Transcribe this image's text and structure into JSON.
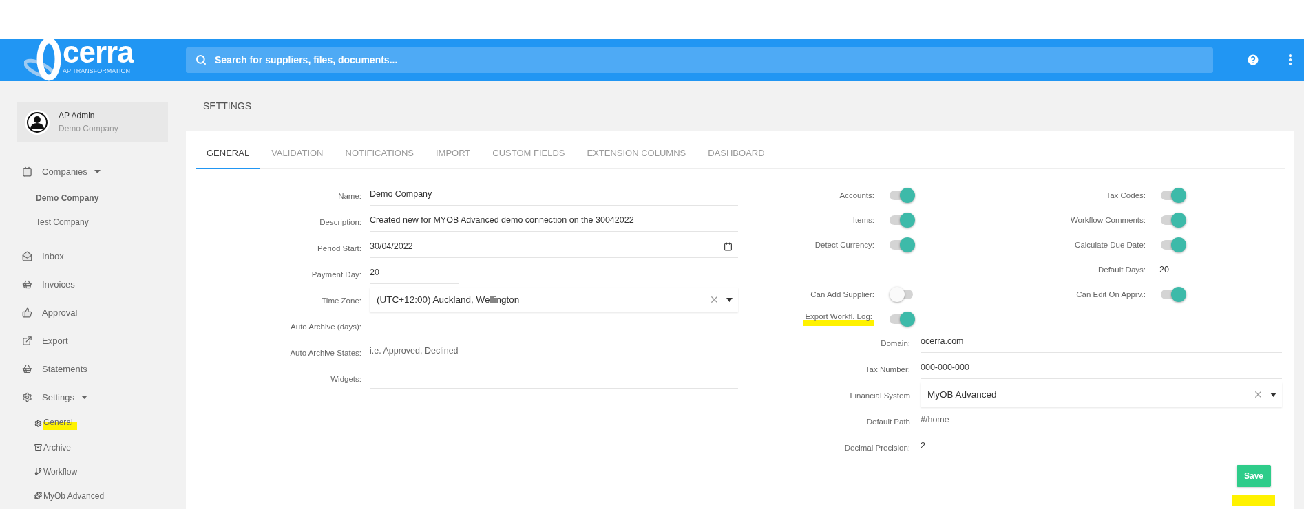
{
  "header": {
    "logo": {
      "text": "cerra",
      "tagline": "AP TRANSFORMATION"
    },
    "search": {
      "placeholder": "Search for suppliers, files, documents..."
    }
  },
  "user": {
    "name": "AP Admin",
    "company": "Demo Company"
  },
  "sidebar": {
    "items": [
      {
        "label": "Companies",
        "expanded": true,
        "children": [
          {
            "label": "Demo Company",
            "selected": true,
            "highlighted": false
          },
          {
            "label": "Test Company",
            "selected": false,
            "highlighted": false
          }
        ]
      },
      {
        "label": "Inbox"
      },
      {
        "label": "Invoices"
      },
      {
        "label": "Approval"
      },
      {
        "label": "Export"
      },
      {
        "label": "Statements"
      },
      {
        "label": "Settings",
        "expanded": true,
        "children": [
          {
            "label": "General",
            "selected": false,
            "highlighted": true
          },
          {
            "label": "Archive",
            "selected": false,
            "highlighted": false
          },
          {
            "label": "Workflow",
            "selected": false,
            "highlighted": false
          },
          {
            "label": "MyOb Advanced",
            "selected": false,
            "highlighted": false
          }
        ]
      }
    ]
  },
  "page_title": "SETTINGS",
  "tabs": [
    {
      "label": "GENERAL",
      "selected": true
    },
    {
      "label": "VALIDATION",
      "selected": false
    },
    {
      "label": "NOTIFICATIONS",
      "selected": false
    },
    {
      "label": "IMPORT",
      "selected": false
    },
    {
      "label": "CUSTOM FIELDS",
      "selected": false
    },
    {
      "label": "EXTENSION COLUMNS",
      "selected": false
    },
    {
      "label": "DASHBOARD",
      "selected": false
    }
  ],
  "general_form": [
    {
      "kind": "text",
      "label": "Name:",
      "value": "Demo Company"
    },
    {
      "kind": "text",
      "label": "Description:",
      "value": "Created new for MYOB Advanced demo connection on the 30042022"
    },
    {
      "kind": "date",
      "label": "Period Start:",
      "value": "30/04/2022"
    },
    {
      "kind": "short",
      "label": "Payment Day:",
      "value": "20"
    },
    {
      "kind": "select",
      "label": "Time Zone:",
      "value": "(UTC+12:00) Auckland, Wellington"
    },
    {
      "kind": "short",
      "label": "Auto Archive (days):"
    },
    {
      "kind": "text",
      "label": "Auto Archive States:",
      "placeholder": "i.e. Approved, Declined"
    },
    {
      "kind": "text",
      "label": "Widgets:"
    }
  ],
  "toggle_rows": [
    {
      "left": {
        "kind": "toggle",
        "label": "Accounts:",
        "on": true,
        "highlighted": false
      },
      "right": {
        "kind": "toggle",
        "label": "Tax Codes:",
        "on": true
      }
    },
    {
      "left": {
        "kind": "toggle",
        "label": "Items:",
        "on": true,
        "highlighted": false
      },
      "right": {
        "kind": "toggle",
        "label": "Workflow Comments:",
        "on": true
      }
    },
    {
      "left": {
        "kind": "toggle",
        "label": "Detect Currency:",
        "on": true,
        "highlighted": false
      },
      "right": {
        "kind": "toggle",
        "label": "Calculate Due Date:",
        "on": true
      }
    },
    {
      "right": {
        "kind": "short",
        "label": "Default Days:",
        "value": "20"
      }
    },
    {
      "left": {
        "kind": "toggle",
        "label": "Can Add Supplier:",
        "on": false,
        "highlighted": false
      },
      "right": {
        "kind": "toggle",
        "label": "Can Edit On Apprv.:",
        "on": true
      }
    },
    {
      "left": {
        "kind": "toggle",
        "label": "Export Workfl. Log:",
        "on": true,
        "highlighted": true
      }
    }
  ],
  "system_form": [
    {
      "kind": "text",
      "label": "Domain:",
      "value": "ocerra.com"
    },
    {
      "kind": "text",
      "label": "Tax Number:",
      "value": "000-000-000"
    },
    {
      "kind": "select",
      "label": "Financial System",
      "value": "MyOB Advanced"
    },
    {
      "kind": "text",
      "label": "Default Path",
      "placeholder": "#/home"
    },
    {
      "kind": "short",
      "label": "Decimal Precision:",
      "value": "2"
    }
  ],
  "save": {
    "label": "Save",
    "highlighted": true
  }
}
